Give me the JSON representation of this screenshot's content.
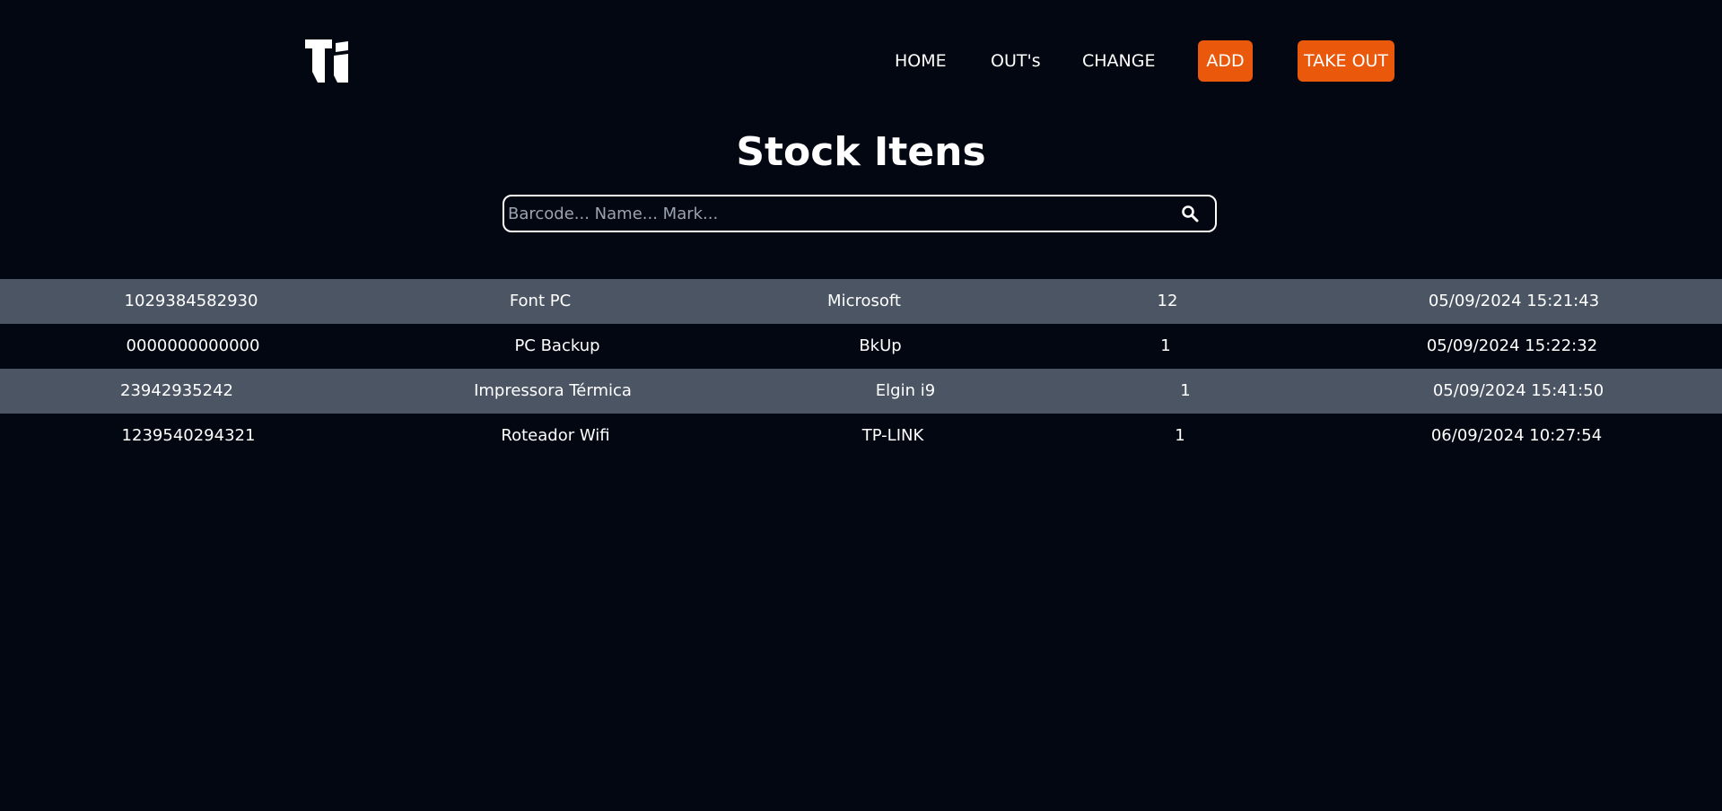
{
  "nav": {
    "logo_icon": "ti-logo-icon",
    "home": "HOME",
    "outs": "OUT's",
    "change": "CHANGE",
    "add": "ADD",
    "take_out": "TAKE OUT"
  },
  "page": {
    "title": "Stock Itens"
  },
  "search": {
    "placeholder": "Barcode... Name... Mark...",
    "value": "",
    "icon": "search-icon"
  },
  "items": [
    {
      "barcode": "1029384582930",
      "name": "Font PC",
      "mark": "Microsoft",
      "quantity": "12",
      "date": "05/09/2024 15:21:43"
    },
    {
      "barcode": "0000000000000",
      "name": "PC Backup",
      "mark": "BkUp",
      "quantity": "1",
      "date": "05/09/2024 15:22:32"
    },
    {
      "barcode": "23942935242",
      "name": "Impressora Térmica",
      "mark": "Elgin i9",
      "quantity": "1",
      "date": "05/09/2024 15:41:50"
    },
    {
      "barcode": "1239540294321",
      "name": "Roteador Wifi",
      "mark": "TP-LINK",
      "quantity": "1",
      "date": "06/09/2024 10:27:54"
    }
  ],
  "colors": {
    "background": "#030712",
    "accent": "#ea580c",
    "row_alt": "#4b5563"
  }
}
